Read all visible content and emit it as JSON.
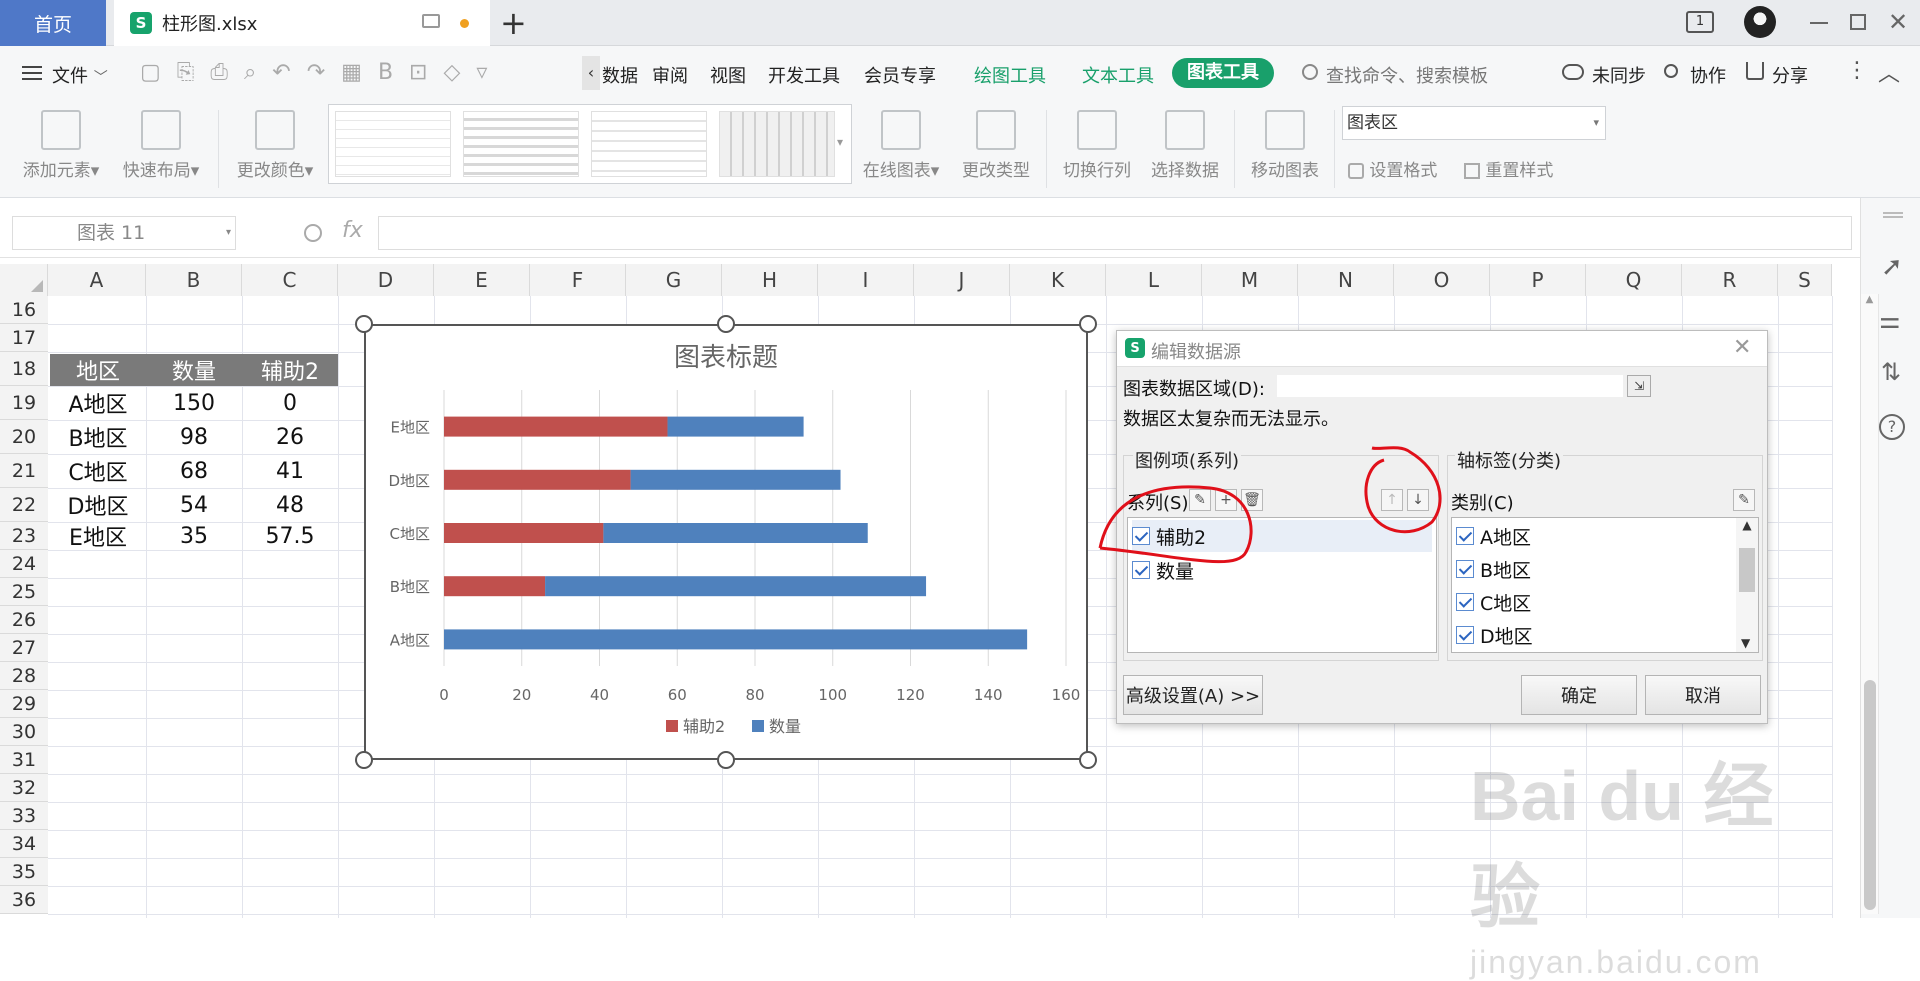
{
  "titlebar": {
    "home_tab": "首页",
    "file_tab": "柱形图.xlsx",
    "new_tab_symbol": "+",
    "page_indicator": "1"
  },
  "menubar": {
    "file_menu": "文件",
    "items": [
      "数据",
      "审阅",
      "视图",
      "开发工具",
      "会员专享"
    ],
    "context_tabs": [
      "绘图工具",
      "文本工具"
    ],
    "active_tab": "图表工具",
    "search_placeholder": "查找命令、搜索模板",
    "sync": "未同步",
    "collab": "协作",
    "share": "分享"
  },
  "ribbon": {
    "add_element": "添加元素",
    "quick_layout": "快速布局",
    "change_color": "更改颜色",
    "online_chart": "在线图表",
    "change_type": "更改类型",
    "switch_rowcol": "切换行列",
    "select_data": "选择数据",
    "move_chart": "移动图表",
    "chart_area_select": "图表区",
    "set_format": "设置格式",
    "reset_style": "重置样式"
  },
  "formula_bar": {
    "name_box": "图表 11",
    "fx": "fx",
    "formula": ""
  },
  "grid": {
    "columns": [
      "A",
      "B",
      "C",
      "D",
      "E",
      "F",
      "G",
      "H",
      "I",
      "J",
      "K",
      "L",
      "M",
      "N",
      "O",
      "P",
      "Q",
      "R",
      "S"
    ],
    "rows": [
      "16",
      "17",
      "18",
      "19",
      "20",
      "21",
      "22",
      "23",
      "24",
      "25",
      "26",
      "27",
      "28",
      "29",
      "30",
      "31",
      "32",
      "33",
      "34",
      "35",
      "36"
    ],
    "table_header": [
      "地区",
      "数量",
      "辅助2"
    ],
    "table_rows": [
      [
        "A地区",
        "150",
        "0"
      ],
      [
        "B地区",
        "98",
        "26"
      ],
      [
        "C地区",
        "68",
        "41"
      ],
      [
        "D地区",
        "54",
        "48"
      ],
      [
        "E地区",
        "35",
        "57.5"
      ]
    ]
  },
  "chart_data": {
    "type": "bar",
    "title": "图表标题",
    "categories": [
      "A地区",
      "B地区",
      "C地区",
      "D地区",
      "E地区"
    ],
    "series": [
      {
        "name": "辅助2",
        "values": [
          0,
          26,
          41,
          48,
          57.5
        ],
        "color": "#c0504d"
      },
      {
        "name": "数量",
        "values": [
          150,
          98,
          68,
          54,
          35
        ],
        "color": "#4f81bd"
      }
    ],
    "stacked": true,
    "orientation": "horizontal",
    "xlim": [
      0,
      160
    ],
    "xticks": [
      "0",
      "20",
      "40",
      "60",
      "80",
      "100",
      "120",
      "140",
      "160"
    ],
    "grid": "vertical",
    "legend": "bottom"
  },
  "dialog": {
    "title": "编辑数据源",
    "range_label": "图表数据区域(D):",
    "range_value": "",
    "message": "数据区太复杂而无法显示。",
    "legend_group": "图例项(系列)",
    "series_label": "系列(S)",
    "series_items": [
      "辅助2",
      "数量"
    ],
    "axis_group": "轴标签(分类)",
    "category_label": "类别(C)",
    "category_items": [
      "A地区",
      "B地区",
      "C地区",
      "D地区"
    ],
    "advanced": "高级设置(A) >>",
    "ok": "确定",
    "cancel": "取消"
  },
  "watermark": {
    "brand": "Bai du 经验",
    "url": "jingyan.baidu.com"
  },
  "colors": {
    "accent": "#4f78c8",
    "chart_tool_green": "#19a06b",
    "annotation_red": "#e0101a"
  }
}
